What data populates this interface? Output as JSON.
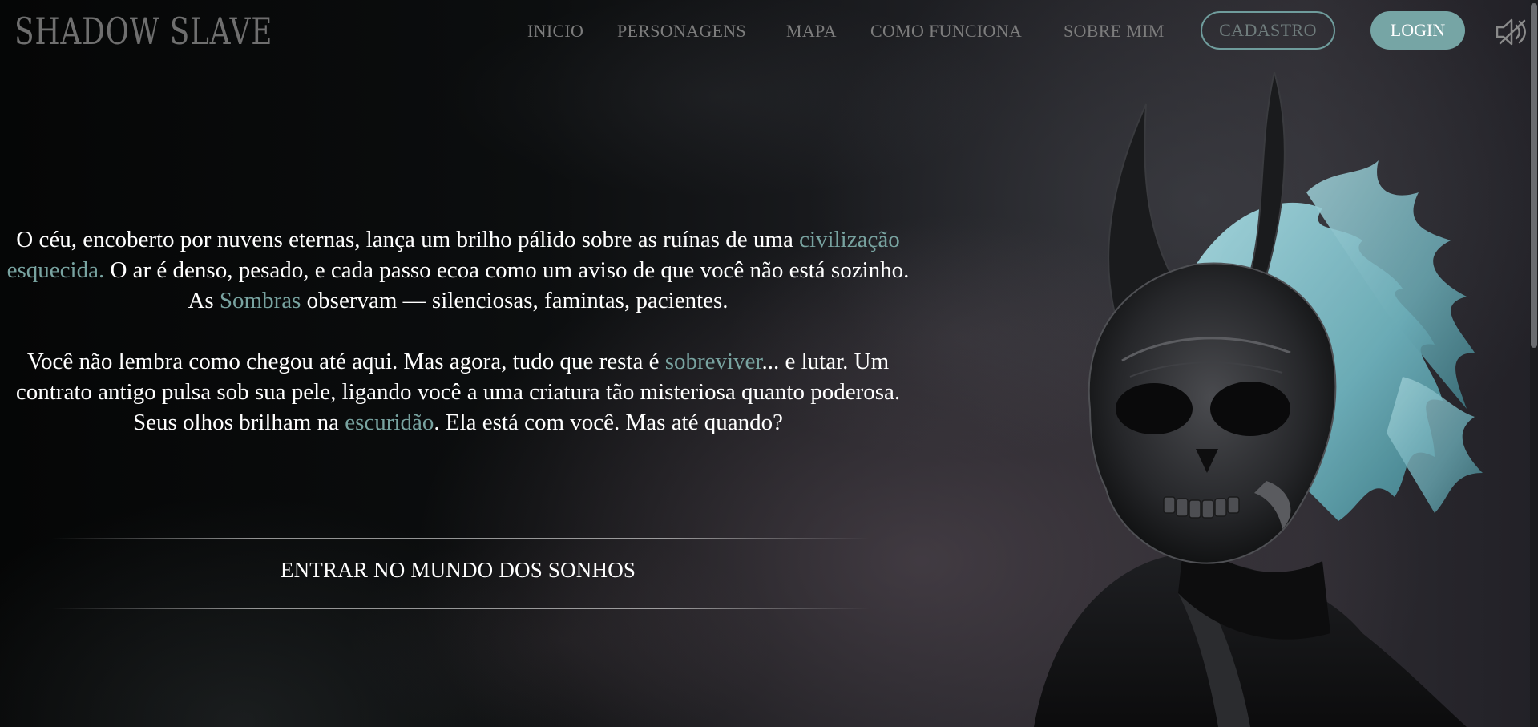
{
  "header": {
    "logo": "SHADOW SLAVE",
    "nav": {
      "inicio": "INICIO",
      "personagens": "PERSONAGENS",
      "mapa": "MAPA",
      "como_funciona": "COMO FUNCIONA",
      "sobre_mim": "SOBRE MIM"
    },
    "cadastro": "CADASTRO",
    "login": "LOGIN",
    "mute_icon": "speaker-muted-icon"
  },
  "story": {
    "p1": {
      "a": "O céu, encoberto por nuvens eternas, lança um brilho pálido sobre as ruínas de uma ",
      "h1": "civilização esquecida.",
      "b": " O ar é denso, pesado, e cada passo ecoa como um aviso de que você não está sozinho. As ",
      "h2": "Sombras",
      "c": " observam — silenciosas, famintas, pacientes."
    },
    "p2": {
      "a": "Você não lembra como chegou até aqui. Mas agora, tudo que resta é ",
      "h1": "sobreviver",
      "b": "... e lutar. Um contrato antigo pulsa sob sua pele, ligando você a uma criatura tão misteriosa quanto poderosa. Seus olhos brilham na ",
      "h2": "escuridão",
      "c": ". Ela está com você. Mas até quando?"
    },
    "cta": "ENTRAR NO MUNDO DOS SONHOS"
  },
  "colors": {
    "accent": "#76a5a5",
    "highlight_text": "#78a3a0",
    "nav_text": "#7d7d7d"
  },
  "hero_image": "masked-shadow-demon-icon"
}
